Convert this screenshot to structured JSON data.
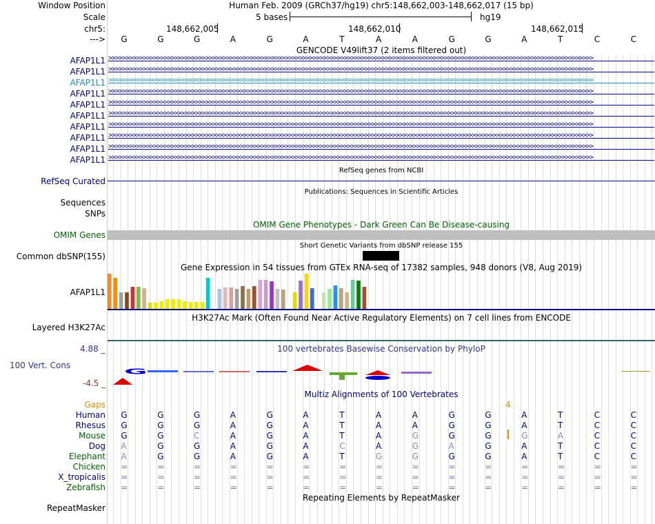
{
  "header": {
    "window_position_label": "Window Position",
    "window_position_value": "Human Feb. 2009 (GRCh37/hg19)   chr5:148,662,003-148,662,017 (15 bp)",
    "scale_label": "Scale",
    "scale_value": "5 bases",
    "scale_db": "hg19",
    "chrom_label": "chr5:",
    "coord_1": "148,662,005",
    "coord_2": "148,662,010",
    "coord_3": "148,662,015",
    "strand_label": "--->"
  },
  "sequence": [
    "G",
    "G",
    "G",
    "A",
    "G",
    "A",
    "T",
    "A",
    "A",
    "G",
    "G",
    "A",
    "T",
    "C",
    "C"
  ],
  "gencode": {
    "title": "GENCODE V49lift37 (2 items filtered out)",
    "genes": [
      "AFAP1L1",
      "AFAP1L1",
      "AFAP1L1",
      "AFAP1L1",
      "AFAP1L1",
      "AFAP1L1",
      "AFAP1L1",
      "AFAP1L1",
      "AFAP1L1",
      "AFAP1L1"
    ],
    "highlight_index": 2
  },
  "refseq": {
    "title": "RefSeq genes from NCBI",
    "label": "RefSeq Curated"
  },
  "publications": {
    "title": "Publications: Sequences in Scientific Articles",
    "label1": "Sequences",
    "label2": "SNPs"
  },
  "omim": {
    "title": "OMIM Gene Phenotypes - Dark Green Can Be Disease-causing",
    "label": "OMIM Genes"
  },
  "dbsnp": {
    "title": "Short Genetic Variants from dbSNP release 155",
    "label": "Common dbSNP(155)"
  },
  "gtex": {
    "title": "Gene Expression in 54 tissues from GTEx RNA-seq of 17382 samples, 948 donors (V8, Aug 2019)",
    "label": "AFAP1L1",
    "bars": [
      {
        "v": 0.98,
        "c": "#f08a2c"
      },
      {
        "v": 0.86,
        "c": "#ff8c00"
      },
      {
        "v": 0.46,
        "c": "#a0a0a0"
      },
      {
        "v": 0.46,
        "c": "#8b4513"
      },
      {
        "v": 0.62,
        "c": "#cc3333"
      },
      {
        "v": 0.62,
        "c": "#7fbf3f"
      },
      {
        "v": 0.58,
        "c": "#d2b48c"
      },
      {
        "v": 0.18,
        "c": "#dddd00"
      },
      {
        "v": 0.18,
        "c": "#eeee00"
      },
      {
        "v": 0.22,
        "c": "#eeee00"
      },
      {
        "v": 0.26,
        "c": "#eeee00"
      },
      {
        "v": 0.26,
        "c": "#eeee00"
      },
      {
        "v": 0.26,
        "c": "#eeee00"
      },
      {
        "v": 0.22,
        "c": "#eeee00"
      },
      {
        "v": 0.2,
        "c": "#eeee00"
      },
      {
        "v": 0.2,
        "c": "#eeee00"
      },
      {
        "v": 0.2,
        "c": "#eeee00"
      },
      {
        "v": 0.86,
        "c": "#00cccc"
      },
      {
        "v": 0.08,
        "c": "#ffffff"
      },
      {
        "v": 0.56,
        "c": "#b0c4de"
      },
      {
        "v": 0.6,
        "c": "#e6b8b8"
      },
      {
        "v": 0.6,
        "c": "#d8a0a0"
      },
      {
        "v": 0.56,
        "c": "#a0a0a0"
      },
      {
        "v": 0.64,
        "c": "#8b6f47"
      },
      {
        "v": 0.56,
        "c": "#c49a6c"
      },
      {
        "v": 0.64,
        "c": "#a0522d"
      },
      {
        "v": 0.8,
        "c": "#dda0dd"
      },
      {
        "v": 0.8,
        "c": "#cc99cc"
      },
      {
        "v": 0.76,
        "c": "#9932cc"
      },
      {
        "v": 0.56,
        "c": "#c0c0c0"
      },
      {
        "v": 0.54,
        "c": "#c0a080"
      },
      {
        "v": 0.2,
        "c": "#ffffff"
      },
      {
        "v": 0.46,
        "c": "#dddd00"
      },
      {
        "v": 0.78,
        "c": "#9370db"
      },
      {
        "v": 0.98,
        "c": "#ffd700"
      },
      {
        "v": 0.58,
        "c": "#4169e1"
      },
      {
        "v": 0.2,
        "c": "#ffffff"
      },
      {
        "v": 0.46,
        "c": "#d0e0b0"
      },
      {
        "v": 0.56,
        "c": "#90ee90"
      },
      {
        "v": 0.66,
        "c": "#1e90ff"
      },
      {
        "v": 0.58,
        "c": "#c0a080"
      },
      {
        "v": 0.46,
        "c": "#d2b48c"
      },
      {
        "v": 0.8,
        "c": "#66cc99"
      },
      {
        "v": 0.78,
        "c": "#008000"
      },
      {
        "v": 0.62,
        "c": "#a0522d"
      },
      {
        "v": 0.1,
        "c": "#ffffff"
      }
    ]
  },
  "h3k27ac": {
    "title": "H3K27Ac Mark (Often Found Near Active Regulatory Elements) on 7 cell lines from ENCODE",
    "label": "Layered H3K27Ac"
  },
  "phylop": {
    "title": "100 vertebrates Basewise Conservation by PhyloP",
    "label": "100 Vert. Cons",
    "max": "4.88 _",
    "min": "-4.5 _"
  },
  "multiz": {
    "title": "Multiz Alignments of 100 Vertebrates",
    "gaps_label": "Gaps",
    "gap_marker": "4",
    "species": [
      {
        "name": "Human",
        "color": "#000080",
        "bases": [
          "G",
          "G",
          "G",
          "A",
          "G",
          "A",
          "T",
          "A",
          "A",
          "G",
          "G",
          "A",
          "T",
          "C",
          "C"
        ],
        "faded": []
      },
      {
        "name": "Rhesus",
        "color": "#000080",
        "bases": [
          "G",
          "G",
          "G",
          "A",
          "G",
          "A",
          "T",
          "A",
          "A",
          "G",
          "G",
          "A",
          "T",
          "C",
          "C"
        ],
        "faded": []
      },
      {
        "name": "Mouse",
        "color": "#006400",
        "bases": [
          "G",
          "G",
          "C",
          "A",
          "G",
          "A",
          "T",
          "A",
          "G",
          "G",
          "G",
          "G",
          "A",
          "C",
          "C"
        ],
        "faded": [
          2,
          8,
          11,
          12
        ]
      },
      {
        "name": "Dog",
        "color": "#000080",
        "bases": [
          "A",
          "G",
          "G",
          "A",
          "G",
          "A",
          "C",
          "A",
          "G",
          "A",
          "G",
          "A",
          "T",
          "C",
          "C"
        ],
        "faded": [
          0,
          6,
          8,
          9
        ]
      },
      {
        "name": "Elephant",
        "color": "#006400",
        "bases": [
          "A",
          "G",
          "G",
          "A",
          "G",
          "A",
          "T",
          "G",
          "G",
          "G",
          "G",
          "A",
          "T",
          "C",
          "C"
        ],
        "faded": [
          0,
          7,
          8
        ]
      },
      {
        "name": "Chicken",
        "color": "#006400",
        "bases": [
          "=",
          "=",
          "=",
          "=",
          "=",
          "=",
          "=",
          "=",
          "=",
          "=",
          "=",
          "=",
          "=",
          "=",
          "="
        ],
        "faded": []
      },
      {
        "name": "X_tropicalis",
        "color": "#000080",
        "bases": [
          "=",
          "=",
          "=",
          "=",
          "=",
          "=",
          "=",
          "=",
          "=",
          "=",
          "=",
          "=",
          "=",
          "=",
          "="
        ],
        "faded": []
      },
      {
        "name": "Zebrafish",
        "color": "#006400",
        "bases": [
          "=",
          "=",
          "=",
          "=",
          "=",
          "=",
          "=",
          "=",
          "=",
          "=",
          "=",
          "=",
          "=",
          "=",
          "="
        ],
        "faded": []
      }
    ]
  },
  "repeatmasker": {
    "title": "Repeating Elements by RepeatMasker",
    "label": "RepeatMasker"
  }
}
